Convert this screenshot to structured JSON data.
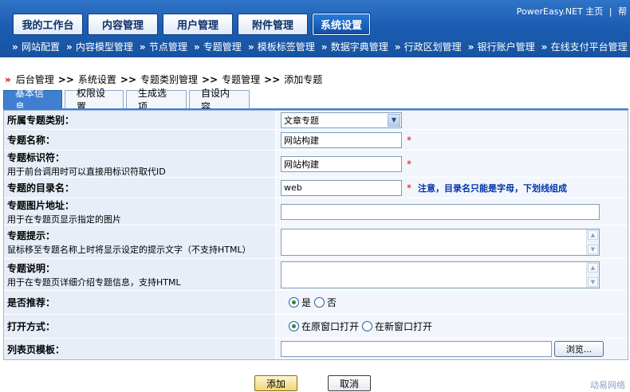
{
  "header": {
    "top_links": [
      "PowerEasy.NET 主页",
      "|",
      "帮"
    ],
    "main_tabs": [
      "我的工作台",
      "内容管理",
      "用户管理",
      "附件管理",
      "系统设置"
    ],
    "sub_nav": [
      "网站配置",
      "内容模型管理",
      "节点管理",
      "专题管理",
      "模板标签管理",
      "数据字典管理",
      "行政区划管理",
      "银行账户管理",
      "在线支付平台管理"
    ]
  },
  "breadcrumb": {
    "arrow": "»",
    "items": [
      "后台管理",
      "系统设置",
      "专题类别管理",
      "专题管理",
      "添加专题"
    ],
    "sep": ">>"
  },
  "tabs": [
    "基本信息",
    "权限设置",
    "生成选项",
    "自设内容"
  ],
  "form": {
    "category": {
      "label": "所属专题类别：",
      "value": "文章专题"
    },
    "name": {
      "label": "专题名称：",
      "value": "网站构建",
      "required": "*"
    },
    "identifier": {
      "label": "专题标识符：",
      "sub": "用于前台调用时可以直接用标识符取代ID",
      "value": "网站构建",
      "required": "*"
    },
    "dir": {
      "label": "专题的目录名：",
      "value": "web",
      "required": "*",
      "note": "注意，目录名只能是字母，下划线组成"
    },
    "image": {
      "label": "专题图片地址：",
      "sub": "用于在专题页显示指定的图片",
      "value": ""
    },
    "tip": {
      "label": "专题提示：",
      "sub": "鼠标移至专题名称上时将显示设定的提示文字（不支持HTML）"
    },
    "desc": {
      "label": "专题说明：",
      "sub": "用于在专题页详细介绍专题信息，支持HTML"
    },
    "recommend": {
      "label": "是否推荐：",
      "options": [
        "是",
        "否"
      ],
      "selected": "是"
    },
    "open": {
      "label": "打开方式：",
      "options": [
        "在原窗口打开",
        "在新窗口打开"
      ],
      "selected": "在原窗口打开"
    },
    "template": {
      "label": "列表页模板：",
      "value": "",
      "browse": "浏览..."
    }
  },
  "buttons": {
    "add": "添加",
    "cancel": "取消"
  },
  "watermark": "动易网络"
}
